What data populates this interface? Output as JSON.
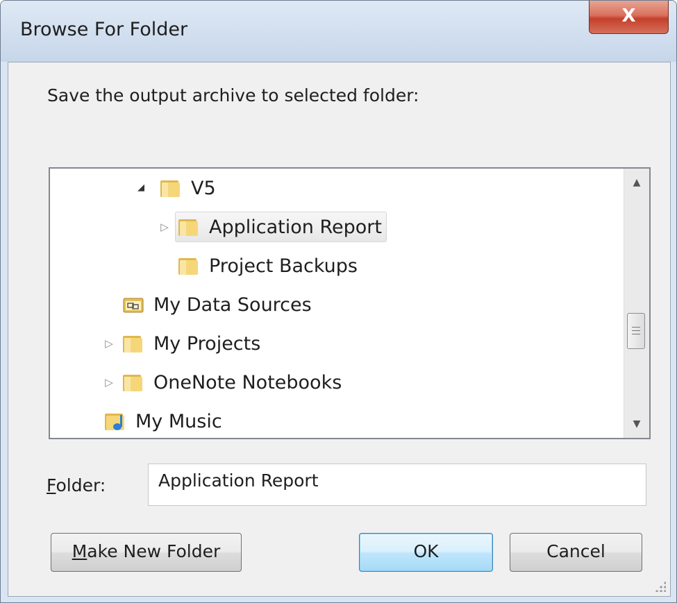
{
  "window": {
    "title": "Browse For Folder",
    "close_label": "X"
  },
  "dialog": {
    "prompt": "Save the output archive to selected folder:"
  },
  "tree": {
    "items": [
      {
        "label": "V5",
        "icon": "folder-icon",
        "expander": "expanded",
        "level": 3,
        "selected": false
      },
      {
        "label": "Application Report",
        "icon": "folder-icon",
        "expander": "collapsed",
        "level": 4,
        "selected": true
      },
      {
        "label": "Project Backups",
        "icon": "folder-icon",
        "expander": "none",
        "level": 4,
        "selected": false
      },
      {
        "label": "My Data Sources",
        "icon": "data-sources-folder-icon",
        "expander": "none",
        "level": 2,
        "selected": false
      },
      {
        "label": "My Projects",
        "icon": "folder-icon",
        "expander": "collapsed",
        "level": 2,
        "selected": false
      },
      {
        "label": "OneNote Notebooks",
        "icon": "folder-icon",
        "expander": "collapsed",
        "level": 2,
        "selected": false
      },
      {
        "label": "My Music",
        "icon": "music-folder-icon",
        "expander": "none",
        "level": 1,
        "selected": false
      }
    ],
    "scroll_up": "▲",
    "scroll_down": "▼"
  },
  "folder": {
    "label_prefix": "F",
    "label_rest": "older:",
    "value": "Application Report"
  },
  "buttons": {
    "make_new_folder_prefix": "M",
    "make_new_folder_rest": "ake New Folder",
    "ok": "OK",
    "cancel": "Cancel"
  },
  "colors": {
    "folder_yellow": "#f2cf6b",
    "close_red": "#c4402c",
    "default_button_blue": "#3c7fb1"
  }
}
